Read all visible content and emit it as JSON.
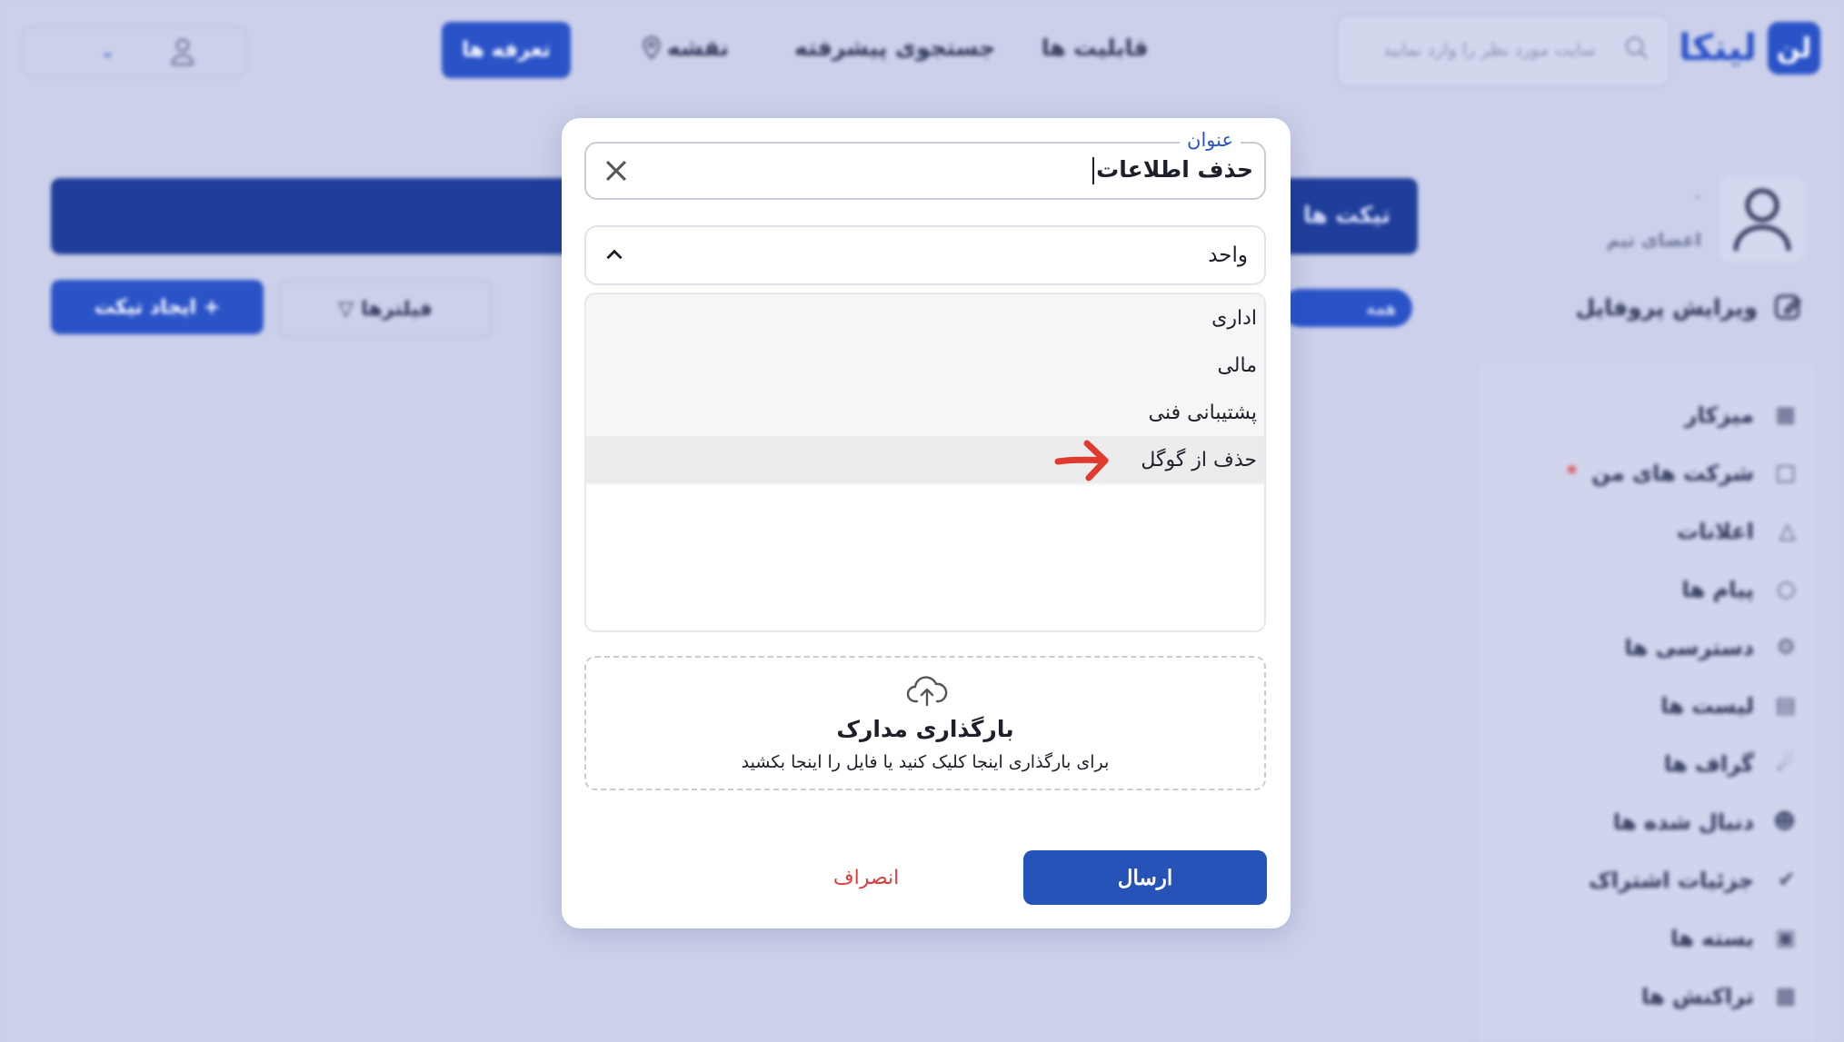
{
  "header": {
    "logo_text": "لینکا",
    "logo_badge": "لن",
    "search_placeholder": "سایت مورد نظر را وارد نمایید",
    "nav": {
      "features": "قابلیت ها",
      "advanced_search": "جستجوی پیشرفته",
      "map": "نقشه",
      "pricing": "تعرفه ها"
    }
  },
  "page": {
    "banner_title": "تیکت ها",
    "create_ticket": "+ ایجاد تیکت",
    "filters": "فیلترها",
    "all_pill": "همه"
  },
  "sidebar": {
    "profile_name": "-",
    "profile_role": "اعضای تیم",
    "edit_profile": "ویرایش پروفایل",
    "items": [
      {
        "label": "میزکار"
      },
      {
        "label": "شرکت های من"
      },
      {
        "label": "اعلانات"
      },
      {
        "label": "پیام ها"
      },
      {
        "label": "دسترسی ها"
      },
      {
        "label": "لیست ها"
      },
      {
        "label": "گراف ها"
      },
      {
        "label": "دنبال شده ها"
      },
      {
        "label": "جزئیات اشتراک"
      },
      {
        "label": "بسته ها"
      },
      {
        "label": "تراکنش ها"
      }
    ]
  },
  "modal": {
    "title_label": "عنوان",
    "title_value": "حذف اطلاعات",
    "unit_label": "واحد",
    "options": [
      {
        "label": "اداری"
      },
      {
        "label": "مالی"
      },
      {
        "label": "پشتیبانی فنی"
      },
      {
        "label": "حذف از گوگل"
      }
    ],
    "upload_title": "بارگذاری مدارک",
    "upload_hint": "برای بارگذاری اینجا کلیک کنید یا فایل را اینجا بکشید",
    "send": "ارسال",
    "cancel": "انصراف"
  },
  "colors": {
    "primary": "#2a53c8",
    "danger": "#e03c3c",
    "annotation_arrow": "#e03a2f"
  }
}
